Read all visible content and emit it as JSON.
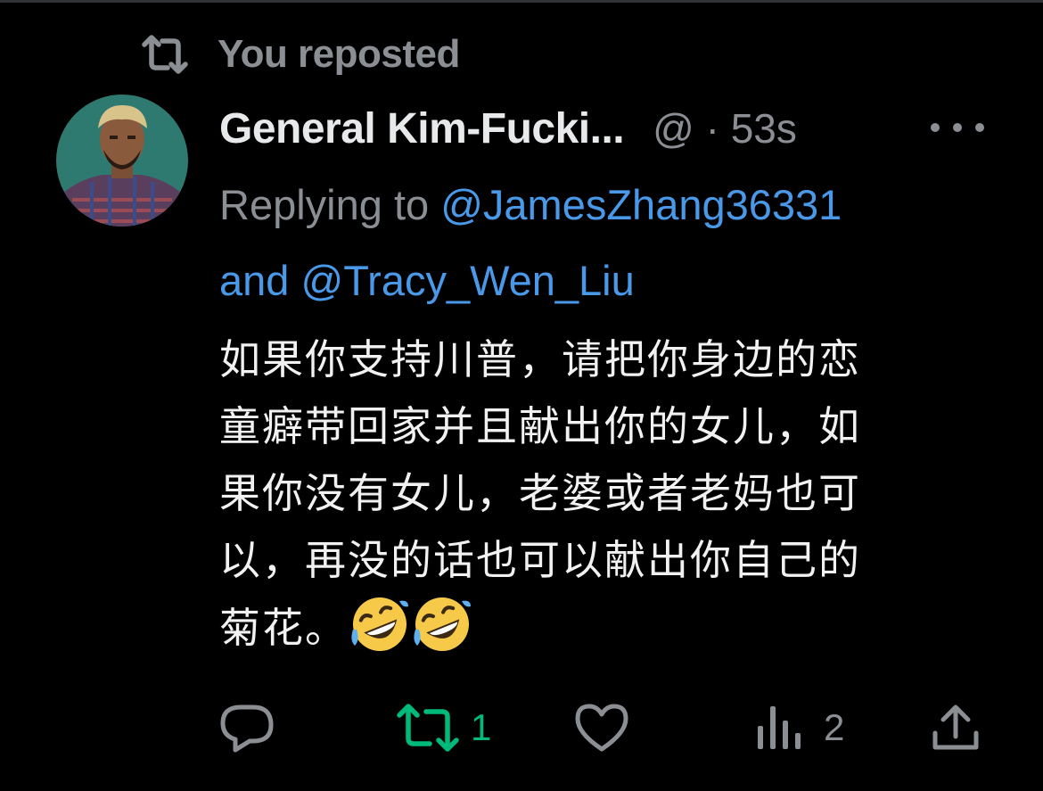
{
  "repost_banner": {
    "text": "You reposted",
    "icon": "repost-icon"
  },
  "tweet": {
    "avatar": "avatar",
    "display_name": "General Kim-Fucki...",
    "meta": "@ · 53s",
    "replying_prefix": "Replying to",
    "reply_handle_1": "@JamesZhang36331",
    "reply_conjunction": "and",
    "reply_handle_2": "@Tracy_Wen_Liu",
    "body_lines": [
      "如果你支持川普，请把你身边的恋",
      "童癖带回家并且献出你的女儿，如",
      "果你没有女儿，老婆或者老妈也可",
      "以，再没的话也可以献出你自己的",
      "菊花。"
    ],
    "emoji": [
      "rolling-on-floor-laughing-emoji",
      "rolling-on-floor-laughing-emoji"
    ]
  },
  "actions": {
    "reply": {
      "icon": "reply-icon"
    },
    "repost": {
      "icon": "repost-icon",
      "count": "1",
      "active": true
    },
    "like": {
      "icon": "heart-icon"
    },
    "views": {
      "icon": "views-icon",
      "count": "2"
    },
    "share": {
      "icon": "share-icon"
    }
  },
  "colors": {
    "background": "#000000",
    "text": "#e7e9ea",
    "secondary": "#8b8f94",
    "link": "#4a99e9",
    "repost_active": "#00ba7c"
  }
}
